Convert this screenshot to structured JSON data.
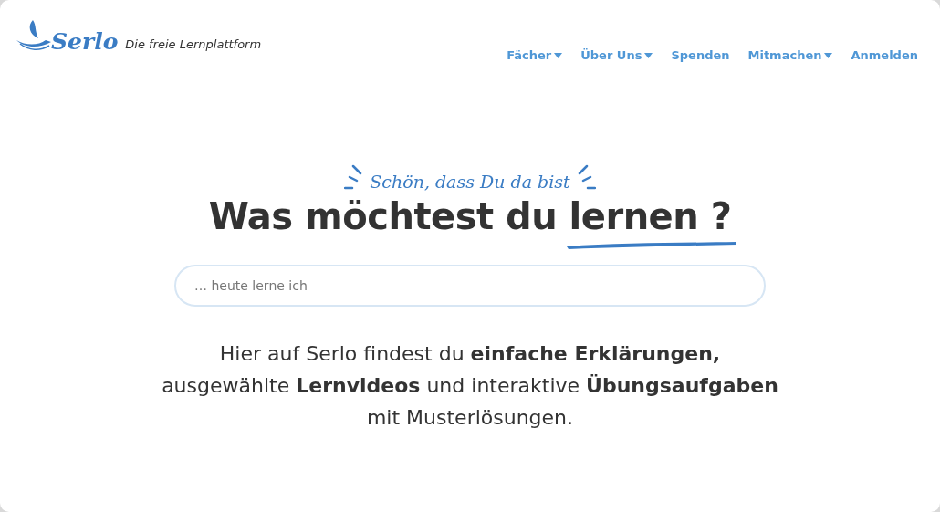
{
  "header": {
    "logo_name": "Serlo",
    "tagline": "Die freie Lernplattform"
  },
  "nav": [
    {
      "label": "Fächer",
      "dropdown": true
    },
    {
      "label": "Über Uns",
      "dropdown": true
    },
    {
      "label": "Spenden",
      "dropdown": false
    },
    {
      "label": "Mitmachen",
      "dropdown": true
    },
    {
      "label": "Anmelden",
      "dropdown": false
    }
  ],
  "hero": {
    "greeting": "Schön, dass Du da bist",
    "heading": "Was möchtest du lernen ?",
    "search": {
      "placeholder": "… heute lerne ich"
    },
    "description": "Hier auf Serlo findest du **einfache Erklärungen,** ausgewählte **Lernvideos** und interaktive **Übungsaufgaben** mit Musterlösungen."
  }
}
